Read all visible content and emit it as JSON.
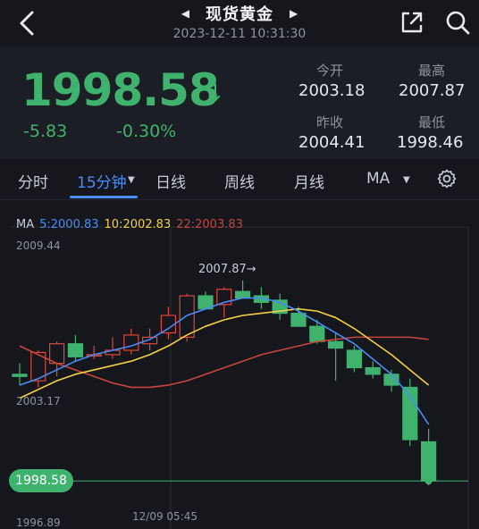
{
  "header": {
    "title": "现货黄金",
    "timestamp": "2023-12-11 10:31:30",
    "icons": [
      "back-arrow-icon",
      "prev-triangle-icon",
      "next-triangle-icon",
      "share-icon",
      "search-icon"
    ]
  },
  "quote": {
    "price": "1998.58",
    "direction_icon": "down-arrow-icon",
    "change": "-5.83",
    "change_pct": "-0.30%",
    "open_label": "今开",
    "open": "2003.18",
    "high_label": "最高",
    "high": "2007.87",
    "prev_close_label": "昨收",
    "prev_close": "2004.41",
    "low_label": "最低",
    "low": "1998.46",
    "colors": {
      "down": "#3fb26e",
      "up": "#e0463c"
    }
  },
  "tabs": {
    "items": [
      "分时",
      "15分钟",
      "日线",
      "周线",
      "月线",
      "MA"
    ],
    "active": "15分钟",
    "settings_icon": "gear-icon"
  },
  "chart": {
    "ma_title": "MA",
    "ma5": "5:2000.83",
    "ma10": "10:2002.83",
    "ma22": "22:2003.83",
    "y_top": "2009.44",
    "y_mid": "2003.17",
    "y_bottom": "1996.89",
    "last_price_tag": "1998.58",
    "high_marker": "2007.87→",
    "x_label": "12/09 05:45",
    "colors": {
      "ma5": "#4a8cf7",
      "ma10": "#f3d046",
      "ma22": "#c8443c",
      "up": "#e0463c",
      "down": "#3fb26e"
    }
  },
  "chart_data": {
    "type": "candlestick",
    "y_range": [
      1996.89,
      2009.44
    ],
    "candles": [
      {
        "o": 2003.5,
        "h": 2004.0,
        "l": 2003.0,
        "c": 2003.4
      },
      {
        "o": 2003.2,
        "h": 2004.6,
        "l": 2002.9,
        "c": 2004.5
      },
      {
        "o": 2004.0,
        "h": 2005.0,
        "l": 2003.4,
        "c": 2004.9
      },
      {
        "o": 2004.9,
        "h": 2005.3,
        "l": 2004.1,
        "c": 2004.3
      },
      {
        "o": 2004.4,
        "h": 2004.8,
        "l": 2004.2,
        "c": 2004.4
      },
      {
        "o": 2004.4,
        "h": 2005.2,
        "l": 2004.2,
        "c": 2004.6
      },
      {
        "o": 2004.6,
        "h": 2005.6,
        "l": 2004.4,
        "c": 2005.3
      },
      {
        "o": 2004.9,
        "h": 2005.6,
        "l": 2004.6,
        "c": 2005.2
      },
      {
        "o": 2005.4,
        "h": 2006.6,
        "l": 2005.1,
        "c": 2006.2
      },
      {
        "o": 2005.2,
        "h": 2007.2,
        "l": 2005.0,
        "c": 2007.1
      },
      {
        "o": 2007.1,
        "h": 2007.3,
        "l": 2006.6,
        "c": 2006.5
      },
      {
        "o": 2006.7,
        "h": 2007.5,
        "l": 2006.1,
        "c": 2007.4
      },
      {
        "o": 2007.3,
        "h": 2007.8,
        "l": 2007.1,
        "c": 2007.0
      },
      {
        "o": 2007.1,
        "h": 2007.5,
        "l": 2006.5,
        "c": 2006.8
      },
      {
        "o": 2006.9,
        "h": 2007.2,
        "l": 2006.0,
        "c": 2006.3
      },
      {
        "o": 2006.3,
        "h": 2006.6,
        "l": 2005.7,
        "c": 2005.7
      },
      {
        "o": 2005.7,
        "h": 2006.0,
        "l": 2004.9,
        "c": 2005.0
      },
      {
        "o": 2005.0,
        "h": 2005.4,
        "l": 2003.2,
        "c": 2004.7
      },
      {
        "o": 2004.6,
        "h": 2004.8,
        "l": 2003.6,
        "c": 2003.8
      },
      {
        "o": 2003.8,
        "h": 2004.1,
        "l": 2003.3,
        "c": 2003.5
      },
      {
        "o": 2003.5,
        "h": 2003.7,
        "l": 2002.7,
        "c": 2003.0
      },
      {
        "o": 2002.9,
        "h": 2003.3,
        "l": 2000.2,
        "c": 2000.5
      },
      {
        "o": 2000.4,
        "h": 2001.0,
        "l": 1998.4,
        "c": 1998.6
      }
    ],
    "ma5": [
      2003.0,
      2003.3,
      2003.7,
      2004.1,
      2004.4,
      2004.6,
      2004.8,
      2005.1,
      2005.6,
      2006.2,
      2006.5,
      2006.8,
      2007.0,
      2007.0,
      2006.8,
      2006.4,
      2005.9,
      2005.4,
      2004.9,
      2004.2,
      2003.5,
      2002.5,
      2001.2
    ],
    "ma10": [
      2002.4,
      2002.8,
      2003.2,
      2003.5,
      2003.7,
      2003.9,
      2004.1,
      2004.4,
      2004.8,
      2005.3,
      2005.7,
      2006.0,
      2006.2,
      2006.3,
      2006.4,
      2006.5,
      2006.4,
      2006.1,
      2005.6,
      2005.0,
      2004.4,
      2003.7,
      2003.0
    ],
    "ma22": [
      2004.8,
      2004.4,
      2004.0,
      2003.7,
      2003.4,
      2003.1,
      2002.9,
      2002.9,
      2003.0,
      2003.2,
      2003.5,
      2003.8,
      2004.1,
      2004.4,
      2004.6,
      2004.8,
      2005.0,
      2005.1,
      2005.2,
      2005.2,
      2005.2,
      2005.2,
      2005.1
    ]
  }
}
